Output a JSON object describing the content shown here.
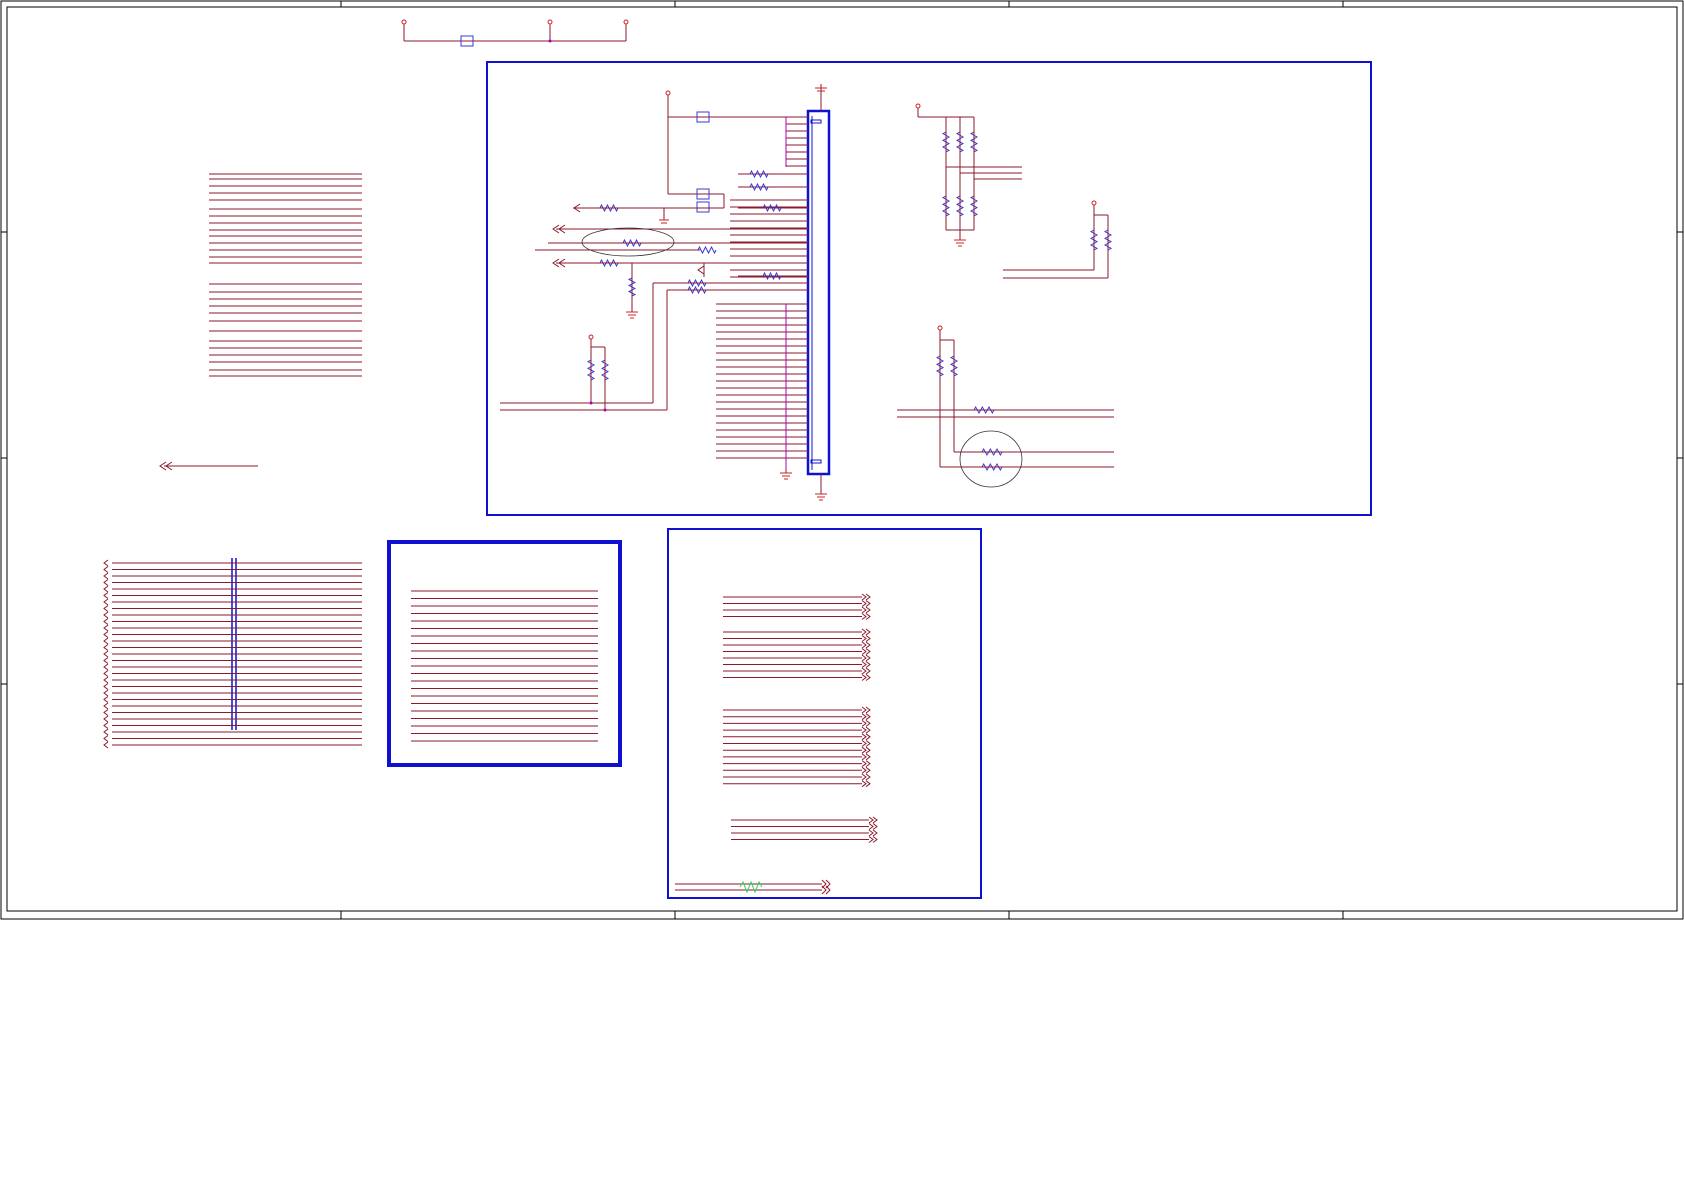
{
  "sheet": {
    "title": "",
    "colors": {
      "wire": "#8b1a2b",
      "junction": "#b000b0",
      "component": "#3a3ad8",
      "block_border": "#1010d0",
      "frame": "#000000",
      "special_wire": "#30d060"
    }
  },
  "blocks": [
    {
      "id": "connector-block",
      "label": ""
    },
    {
      "id": "bus-block",
      "label": ""
    },
    {
      "id": "port-block",
      "label": ""
    }
  ],
  "icons": [
    "resistor-icon",
    "capacitor-icon",
    "ground-icon",
    "power-port-icon",
    "offpage-connector-icon",
    "connector-header-icon"
  ]
}
